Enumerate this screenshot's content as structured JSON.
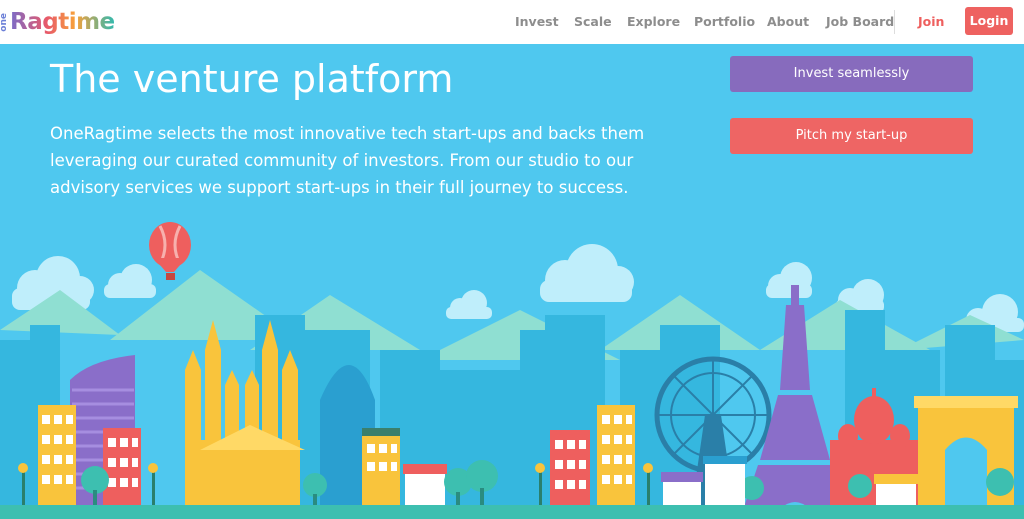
{
  "brand": {
    "prefix": "one",
    "name": "Ragtime"
  },
  "nav": {
    "links": [
      "Invest",
      "Scale",
      "Explore",
      "Portfolio",
      "About",
      "Job Board"
    ],
    "join_label": "Join",
    "login_label": "Login"
  },
  "hero": {
    "title": "The venture platform",
    "description": "OneRagtime selects the most innovative tech start-ups and backs them leveraging our curated community of investors. From our studio to our advisory services we support start-ups in their full journey to success."
  },
  "cta": {
    "invest_label": "Invest seamlessly",
    "pitch_label": "Pitch my start-up"
  },
  "colors": {
    "sky": "#4fc8ef",
    "accent_red": "#ee6260",
    "accent_purple": "#876bbd",
    "ground": "#3dbfb0"
  }
}
